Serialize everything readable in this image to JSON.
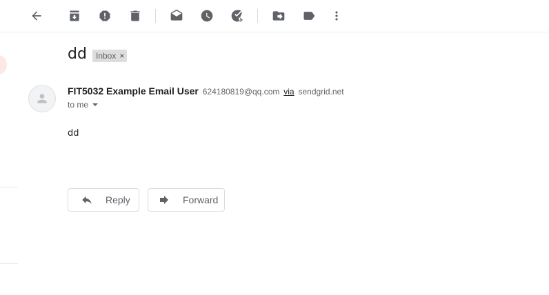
{
  "toolbar": {
    "icons": [
      "back-arrow-icon",
      "archive-icon",
      "report-spam-icon",
      "delete-icon",
      "mark-unread-icon",
      "snooze-icon",
      "add-to-tasks-icon",
      "move-to-icon",
      "label-icon",
      "more-vert-icon"
    ]
  },
  "email": {
    "subject": "dd",
    "label": "Inbox",
    "label_remove": "×",
    "sender_name": "FIT5032 Example Email User",
    "sender_email": "624180819@qq.com",
    "via_text": "via",
    "via_domain": "sendgrid.net",
    "recipient": "to me",
    "body": "dd"
  },
  "actions": {
    "reply_label": "Reply",
    "forward_label": "Forward"
  },
  "colors": {
    "icon": "#5f6368",
    "chip_bg": "#dddddd",
    "border": "#dadce0"
  }
}
